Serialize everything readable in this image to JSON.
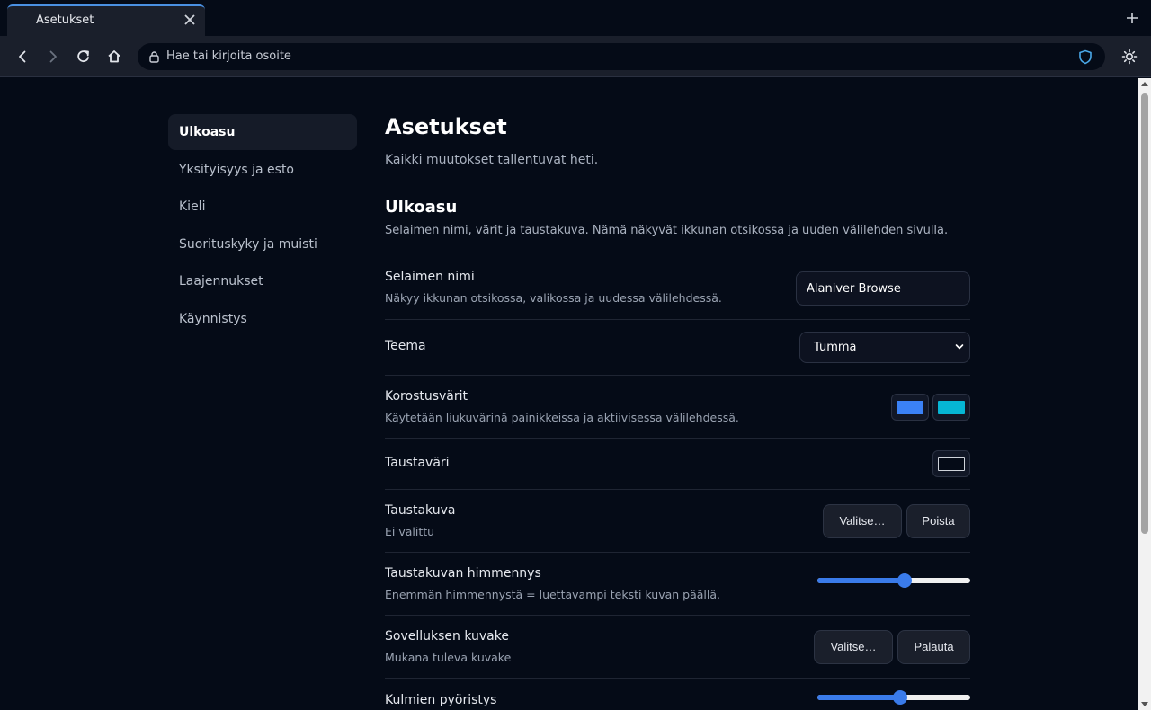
{
  "browser": {
    "tab": {
      "title": "Asetukset"
    },
    "address_bar": {
      "placeholder": "Hae tai kirjoita osoite"
    },
    "icons": [
      "back-icon",
      "forward-icon",
      "reload-icon",
      "home-icon",
      "lock-icon",
      "shield-icon",
      "sun-icon",
      "close-icon",
      "plus-icon"
    ]
  },
  "sidebar": {
    "items": [
      {
        "label": "Ulkoasu",
        "active": true
      },
      {
        "label": "Yksityisyys ja esto",
        "active": false
      },
      {
        "label": "Kieli",
        "active": false
      },
      {
        "label": "Suorituskyky ja muisti",
        "active": false
      },
      {
        "label": "Laajennukset",
        "active": false
      },
      {
        "label": "Käynnistys",
        "active": false
      }
    ]
  },
  "main": {
    "title": "Asetukset",
    "subtitle": "Kaikki muutokset tallentuvat heti.",
    "section": {
      "title": "Ulkoasu",
      "description": "Selaimen nimi, värit ja taustakuva. Nämä näkyvät ikkunan otsikossa ja uuden välilehden sivulla."
    },
    "settings": {
      "browser_name": {
        "label": "Selaimen nimi",
        "description": "Näkyy ikkunan otsikossa, valikossa ja uudessa välilehdessä.",
        "value": "Alaniver Browse"
      },
      "theme": {
        "label": "Teema",
        "value": "Tumma"
      },
      "accent_colors": {
        "label": "Korostusvärit",
        "description": "Käytetään liukuvärinä painikkeissa ja aktiivisessa välilehdessä.",
        "color_1": "#3b82f6",
        "color_2": "#06b6d4"
      },
      "background_color": {
        "label": "Taustaväri",
        "color": "#050b17"
      },
      "background_image": {
        "label": "Taustakuva",
        "description": "Ei valittu",
        "choose_label": "Valitse…",
        "remove_label": "Poista"
      },
      "background_dim": {
        "label": "Taustakuvan himmennys",
        "description": "Enemmän himmennystä = luettavampi teksti kuvan päällä.",
        "value": 0.57
      },
      "app_icon": {
        "label": "Sovelluksen kuvake",
        "description": "Mukana tuleva kuvake",
        "choose_label": "Valitse…",
        "reset_label": "Palauta"
      },
      "corner_radius": {
        "label": "Kulmien pyöristys",
        "value": 0.54
      }
    }
  },
  "colors": {
    "accent": "#3a7bea",
    "page_bg": "#050b17",
    "panel_bg": "#1a1f2b"
  }
}
